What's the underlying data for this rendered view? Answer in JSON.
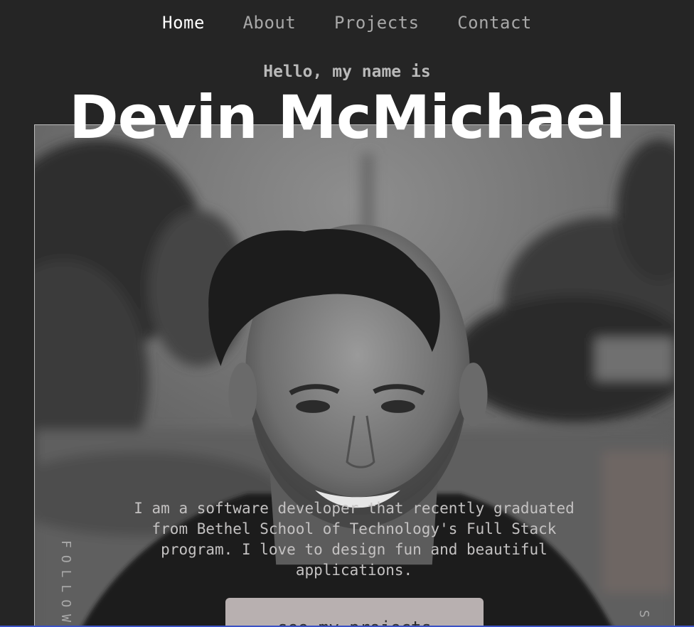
{
  "nav": {
    "items": [
      {
        "label": "Home",
        "active": true
      },
      {
        "label": "About",
        "active": false
      },
      {
        "label": "Projects",
        "active": false
      },
      {
        "label": "Contact",
        "active": false
      }
    ]
  },
  "hero": {
    "greeting": "Hello, my name is",
    "name": "Devin McMichael",
    "photo_icon": "portrait-photo",
    "bio": "I am a software developer that recently graduated from Bethel School of Technology's Full Stack program. I love to design fun and beautiful applications.",
    "cta_label": "see my projects"
  },
  "side": {
    "follow_label": "FOLLOW",
    "right_label": "S"
  },
  "colors": {
    "background": "#252525",
    "nav_active": "#ffffff",
    "nav_inactive": "#a8a8a8",
    "cta_bg": "#b8b0b0"
  }
}
